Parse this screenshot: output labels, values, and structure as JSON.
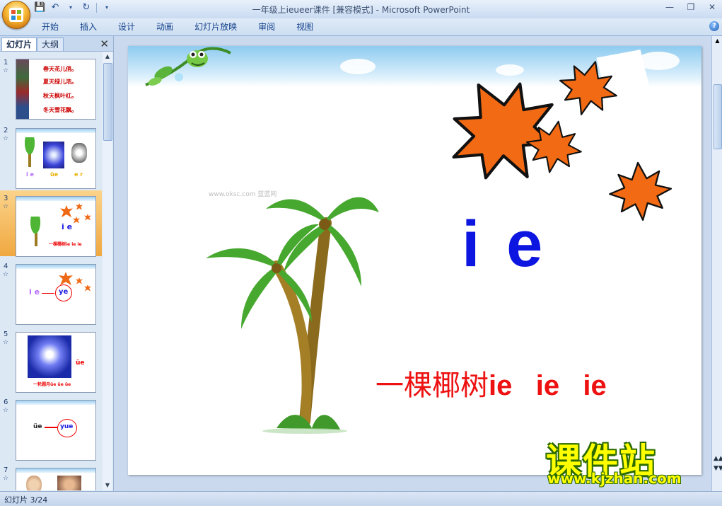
{
  "window": {
    "title": "一年级上ieueer课件 [兼容模式] - Microsoft PowerPoint"
  },
  "ribbon": {
    "tabs": [
      "开始",
      "插入",
      "设计",
      "动画",
      "幻灯片放映",
      "审阅",
      "视图"
    ]
  },
  "left_pane": {
    "tab_slides": "幻灯片",
    "tab_outline": "大纲",
    "thumbnails": [
      {
        "num": "1",
        "lines": [
          "春天花儿俏。",
          "夏天绿儿浓。",
          "秋天枫叶红。",
          "冬天雪花飘。"
        ]
      },
      {
        "num": "2",
        "labels": [
          "i e",
          "üe",
          "e r"
        ]
      },
      {
        "num": "3",
        "labels": [
          "i e",
          "一棵椰树ie  ie  ie"
        ]
      },
      {
        "num": "4",
        "labels": [
          "i e",
          "ye"
        ]
      },
      {
        "num": "5",
        "labels": [
          "üe",
          "一轮圆月üe  üe  üe"
        ]
      },
      {
        "num": "6",
        "labels": [
          "üe",
          "yue"
        ]
      },
      {
        "num": "7",
        "labels": []
      }
    ],
    "active_index": 2
  },
  "slide": {
    "letters": "i e",
    "caption_cn": "一棵椰树",
    "caption_pinyin": "ie   ie   ie",
    "watermark": "www.oksc.com 蓝蓝网"
  },
  "status": {
    "text": "幻灯片 3/24"
  },
  "overlay": {
    "logo_cn": "课件站",
    "logo_url": "www.kjzhan.com"
  },
  "colors": {
    "letters": "#0d15e0",
    "caption": "#ee1111",
    "leaf": "#ef6a16",
    "active_thumb": "#f0a840"
  }
}
